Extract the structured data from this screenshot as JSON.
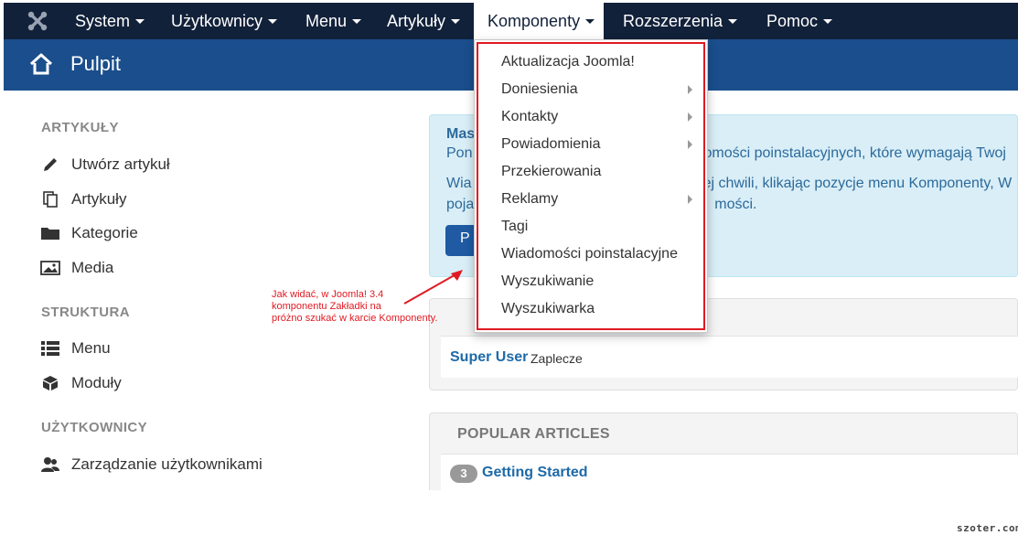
{
  "navbar": {
    "logo_icon": "joomla-logo-icon",
    "items": [
      {
        "label": "System"
      },
      {
        "label": "Użytkownicy"
      },
      {
        "label": "Menu"
      },
      {
        "label": "Artykuły"
      },
      {
        "label": "Komponenty",
        "active": true
      },
      {
        "label": "Rozszerzenia"
      },
      {
        "label": "Pomoc"
      }
    ]
  },
  "subhead": {
    "icon": "home-icon",
    "title": "Pulpit"
  },
  "sidebar": {
    "sections": [
      {
        "heading": "ARTYKUŁY",
        "links": [
          {
            "label": "Utwórz artykuł",
            "icon": "pencil-icon"
          },
          {
            "label": "Artykuły",
            "icon": "stack-icon"
          },
          {
            "label": "Kategorie",
            "icon": "folder-icon"
          },
          {
            "label": "Media",
            "icon": "image-icon"
          }
        ]
      },
      {
        "heading": "STRUKTURA",
        "links": [
          {
            "label": "Menu",
            "icon": "list-icon"
          },
          {
            "label": "Moduły",
            "icon": "cube-icon"
          }
        ]
      },
      {
        "heading": "UŻYTKOWNICY",
        "links": [
          {
            "label": "Zarządzanie użytkownikami",
            "icon": "users-icon"
          }
        ]
      }
    ]
  },
  "info_box": {
    "title": "Mas",
    "line1_left": "Pon",
    "line1_right": "omości poinstalacyjnych, które wymagają Twoj",
    "line2_left": "Wia",
    "line2_right": "ej chwili, klikając pozycje menu Komponenty, W",
    "line3_left": "poja",
    "line3_right": "mości.",
    "button_label": "P"
  },
  "users_panel": {
    "user_name": "Super User",
    "user_location": "Zaplecze"
  },
  "popular_panel": {
    "title": "POPULAR ARTICLES",
    "items": [
      {
        "hits": "3",
        "title": "Getting Started"
      }
    ]
  },
  "dropdown": {
    "items": [
      {
        "label": "Aktualizacja Joomla!",
        "submenu": false
      },
      {
        "label": "Doniesienia",
        "submenu": true
      },
      {
        "label": "Kontakty",
        "submenu": true
      },
      {
        "label": "Powiadomienia",
        "submenu": true
      },
      {
        "label": "Przekierowania",
        "submenu": false
      },
      {
        "label": "Reklamy",
        "submenu": true
      },
      {
        "label": "Tagi",
        "submenu": false
      },
      {
        "label": "Wiadomości poinstalacyjne",
        "submenu": false
      },
      {
        "label": "Wyszukiwanie",
        "submenu": false
      },
      {
        "label": "Wyszukiwarka",
        "submenu": false
      }
    ]
  },
  "annotation": {
    "lines": [
      "Jak widać, w Joomla! 3.4",
      "komponentu Zakładki na",
      "próżno szukać w karcie Komponenty."
    ]
  },
  "watermark": "szoter.com",
  "colors": {
    "navbar": "#12213a",
    "subhead": "#1a4e8c",
    "link": "#1e6aa8",
    "highlight": "#e01a22",
    "info_bg": "#d9eef7"
  }
}
